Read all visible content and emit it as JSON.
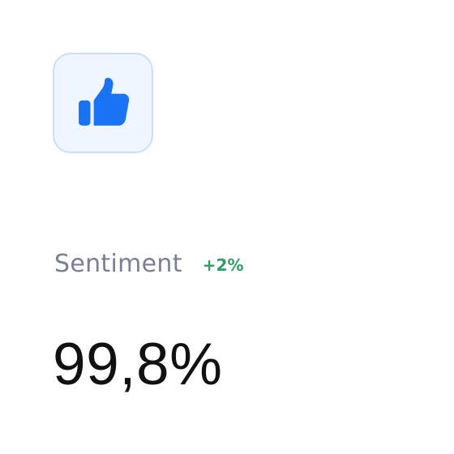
{
  "card": {
    "icon": "thumbs-up-icon",
    "accent_color": "#1a73f5",
    "icon_tile_background": "#eff6ff",
    "label": "Sentiment",
    "change": "+2%",
    "change_color": "#2f9e62",
    "value": "99,8%"
  }
}
